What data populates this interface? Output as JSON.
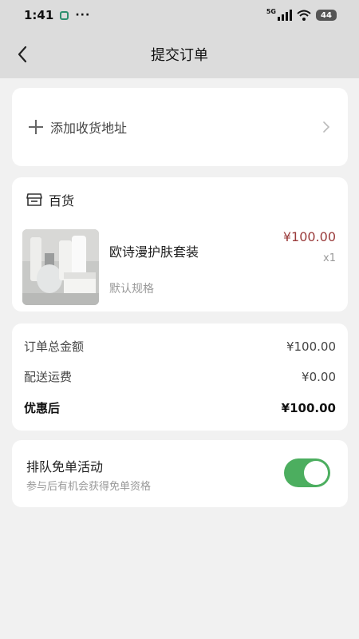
{
  "status_bar": {
    "time": "1:41",
    "more": "···",
    "network": "5G",
    "battery": "44"
  },
  "nav": {
    "title": "提交订单",
    "back_icon": "chevron-left-icon"
  },
  "address": {
    "add_label": "添加收货地址",
    "icon": "plus-icon"
  },
  "order": {
    "shop_name": "百货",
    "shop_icon": "store-icon",
    "product": {
      "name": "欧诗漫护肤套装",
      "spec": "默认规格",
      "price": "¥100.00",
      "quantity": "x1"
    }
  },
  "summary": {
    "rows": [
      {
        "label": "订单总金额",
        "value": "¥100.00"
      },
      {
        "label": "配送运费",
        "value": "¥0.00"
      },
      {
        "label": "优惠后",
        "value": "¥100.00"
      }
    ]
  },
  "activity": {
    "title": "排队免单活动",
    "description": "参与后有机会获得免单资格",
    "enabled": true
  },
  "colors": {
    "accent_green": "#4cae5f",
    "price_red": "#9a3b3b"
  }
}
